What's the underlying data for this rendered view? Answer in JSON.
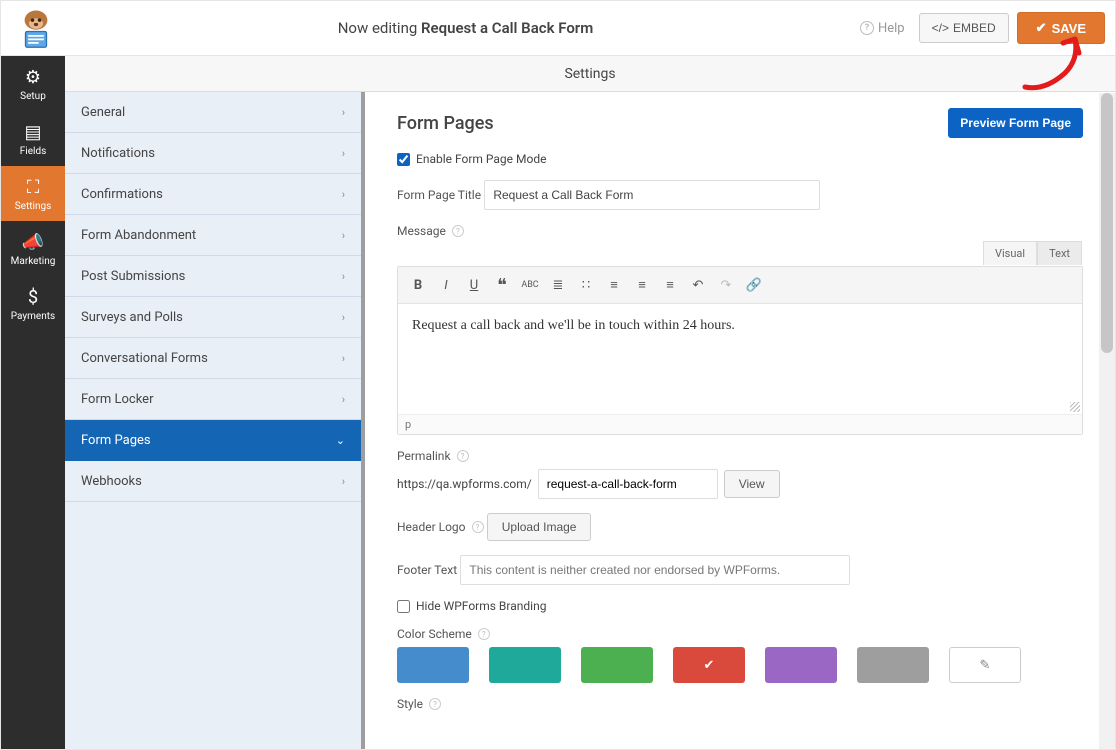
{
  "topbar": {
    "editing_prefix": "Now editing",
    "form_name": "Request a Call Back Form",
    "help_label": "Help",
    "embed_label": "EMBED",
    "save_label": "SAVE"
  },
  "nav": {
    "setup": "Setup",
    "fields": "Fields",
    "settings": "Settings",
    "marketing": "Marketing",
    "payments": "Payments"
  },
  "section_header": "Settings",
  "sidemenu": {
    "items": [
      {
        "label": "General",
        "active": false
      },
      {
        "label": "Notifications",
        "active": false
      },
      {
        "label": "Confirmations",
        "active": false
      },
      {
        "label": "Form Abandonment",
        "active": false
      },
      {
        "label": "Post Submissions",
        "active": false
      },
      {
        "label": "Surveys and Polls",
        "active": false
      },
      {
        "label": "Conversational Forms",
        "active": false
      },
      {
        "label": "Form Locker",
        "active": false
      },
      {
        "label": "Form Pages",
        "active": true
      },
      {
        "label": "Webhooks",
        "active": false
      }
    ]
  },
  "main": {
    "heading": "Form Pages",
    "preview_btn": "Preview Form Page",
    "enable_label": "Enable Form Page Mode",
    "title_label": "Form Page Title",
    "title_value": "Request a Call Back Form",
    "message_label": "Message",
    "editor_tabs": {
      "visual": "Visual",
      "text": "Text"
    },
    "editor_text": "Request a call back and we'll be in touch within 24 hours.",
    "editor_status": "p",
    "permalink_label": "Permalink",
    "permalink_base": "https://qa.wpforms.com/",
    "permalink_slug": "request-a-call-back-form",
    "view_btn": "View",
    "header_logo_label": "Header Logo",
    "upload_btn": "Upload Image",
    "footer_text_label": "Footer Text",
    "footer_text_value": "This content is neither created nor endorsed by WPForms.",
    "hide_branding_label": "Hide WPForms Branding",
    "color_scheme_label": "Color Scheme",
    "colors": [
      "#448ccb",
      "#1fa99a",
      "#4caf50",
      "#d94a3c",
      "#9a67c4",
      "#9e9e9e"
    ],
    "selected_color_index": 3,
    "style_label": "Style"
  }
}
